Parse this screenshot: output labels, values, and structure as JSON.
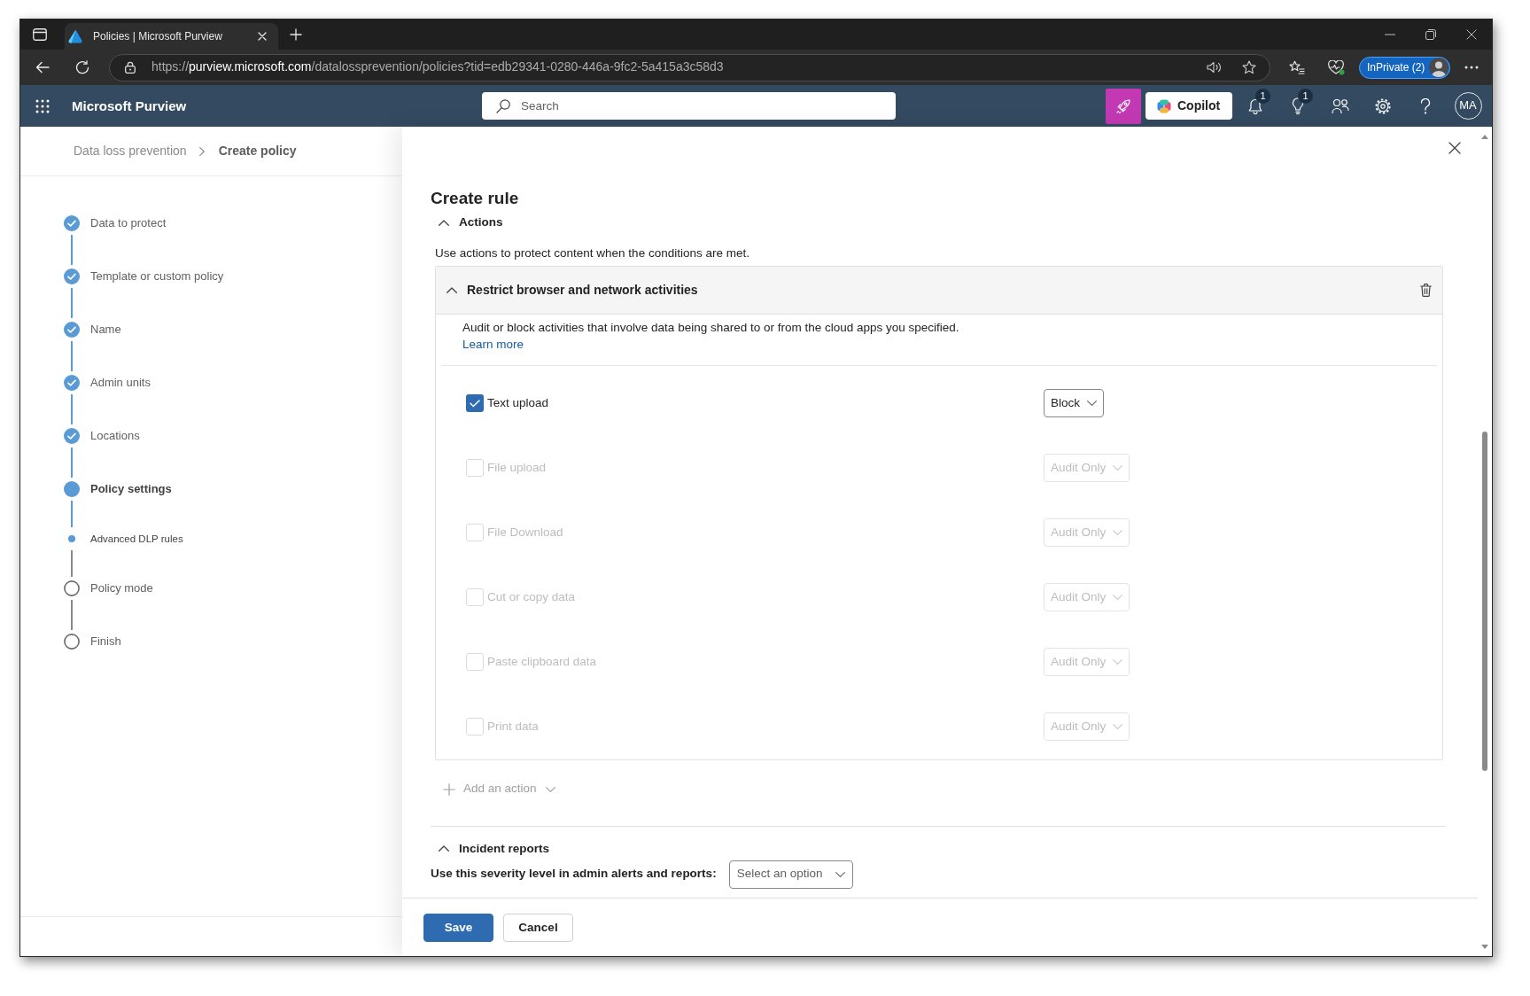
{
  "browser": {
    "tabs": [
      {
        "title": "Policies | Microsoft Purview",
        "selected": true
      }
    ],
    "url": {
      "scheme": "https://",
      "host": "purview.microsoft.com",
      "path": "/datalossprevention/policies?tid=edb29341-0280-446a-9fc2-5a415a3c58d3"
    },
    "profile": {
      "label": "InPrivate (2)"
    }
  },
  "app": {
    "title": "Microsoft Purview",
    "search": {
      "placeholder": "Search"
    },
    "tools": [
      {
        "kind": "rocket"
      },
      {
        "kind": "copilot",
        "label": "Copilot"
      },
      {
        "kind": "bell",
        "badge": "1"
      },
      {
        "kind": "lightbulb",
        "badge": "1"
      },
      {
        "kind": "people"
      },
      {
        "kind": "settings"
      },
      {
        "kind": "help"
      }
    ],
    "avatar": "MA"
  },
  "breadcrumb": [
    {
      "label": "Data loss prevention",
      "selected": false
    },
    {
      "label": "Create policy",
      "selected": true
    }
  ],
  "steps": [
    {
      "label": "Data to protect",
      "kind": "step",
      "completed": true,
      "current": false
    },
    {
      "label": "Template or custom policy",
      "kind": "step",
      "completed": true,
      "current": false
    },
    {
      "label": "Name",
      "kind": "step",
      "completed": true,
      "current": false
    },
    {
      "label": "Admin units",
      "kind": "step",
      "completed": true,
      "current": false
    },
    {
      "label": "Locations",
      "kind": "step",
      "completed": true,
      "current": false
    },
    {
      "label": "Policy settings",
      "kind": "step",
      "completed": false,
      "current": true
    },
    {
      "label": "Advanced DLP rules",
      "kind": "substep",
      "completed": false,
      "current": true
    },
    {
      "label": "Policy mode",
      "kind": "step",
      "completed": false,
      "current": false
    },
    {
      "label": "Finish",
      "kind": "step",
      "completed": false,
      "current": false
    }
  ],
  "panel": {
    "title": "Create rule",
    "actions": {
      "title": "Actions",
      "expanded": true,
      "intro": "Use actions to protect content when the conditions are met.",
      "card": {
        "title": "Restrict browser and network activities",
        "expanded": true,
        "description": "Audit or block activities that involve data being shared to or from the cloud apps you specified.",
        "link": "Learn more",
        "activities": [
          {
            "label": "Text upload",
            "checked": true,
            "disabled": false,
            "value": "Block"
          },
          {
            "label": "File upload",
            "checked": false,
            "disabled": true,
            "value": "Audit Only"
          },
          {
            "label": "File Download",
            "checked": false,
            "disabled": true,
            "value": "Audit Only"
          },
          {
            "label": "Cut or copy data",
            "checked": false,
            "disabled": true,
            "value": "Audit Only"
          },
          {
            "label": "Paste clipboard data",
            "checked": false,
            "disabled": true,
            "value": "Audit Only"
          },
          {
            "label": "Print data",
            "checked": false,
            "disabled": true,
            "value": "Audit Only"
          }
        ]
      },
      "add_action": {
        "label": "Add an action",
        "disabled": true
      }
    },
    "incident_reports": {
      "title": "Incident reports",
      "expanded": true,
      "severity": {
        "label": "Use this severity level in admin alerts and reports:",
        "placeholder": "Select an option"
      }
    }
  },
  "footer": {
    "buttons": [
      {
        "label": "Save",
        "kind": "primary"
      },
      {
        "label": "Cancel",
        "kind": "secondary"
      }
    ]
  }
}
